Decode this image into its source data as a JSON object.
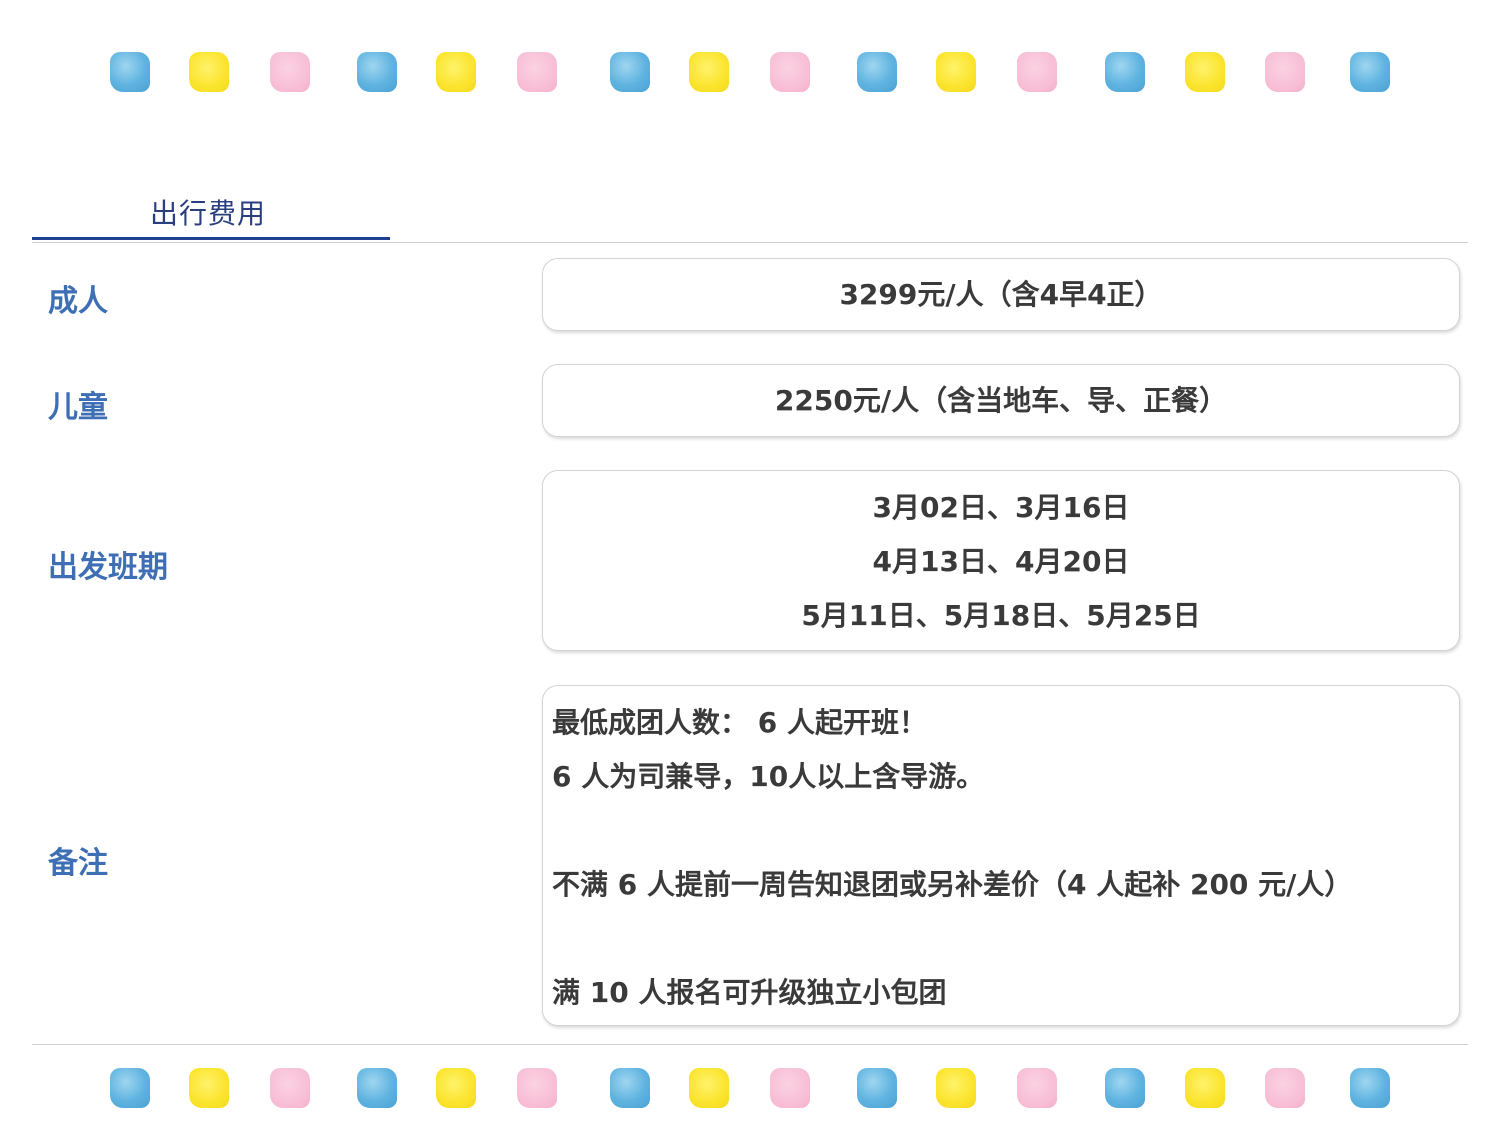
{
  "colors": {
    "tab_underline": "#1f3f8f",
    "tab_text": "#2b3f7e",
    "label_text": "#3e6eb4",
    "value_text": "#3a3a3a",
    "dot_blue": "#5fb3e0",
    "dot_yellow": "#fbe42d",
    "dot_pink": "#f7bcd4"
  },
  "decoration": {
    "dot_pattern": [
      "blue",
      "yellow",
      "pink",
      "blue",
      "yellow",
      "pink",
      "blue",
      "yellow",
      "pink",
      "blue",
      "yellow",
      "pink",
      "blue",
      "yellow",
      "pink",
      "blue"
    ]
  },
  "tab": {
    "label": "出行费用"
  },
  "rows": {
    "adult": {
      "label": "成人",
      "value": "3299元/人（含4早4正）"
    },
    "child": {
      "label": "儿童",
      "value": "2250元/人（含当地车、导、正餐）"
    },
    "departures": {
      "label": "出发班期",
      "lines": [
        "3月02日、3月16日",
        "4月13日、4月20日",
        "5月11日、5月18日、5月25日"
      ]
    },
    "notes": {
      "label": "备注",
      "lines": [
        "最低成团人数：  6 人起开班！",
        "6 人为司兼导，10人以上含导游。",
        "不满 6 人提前一周告知退团或另补差价（4 人起补 200 元/人）",
        "满 10 人报名可升级独立小包团"
      ]
    }
  }
}
